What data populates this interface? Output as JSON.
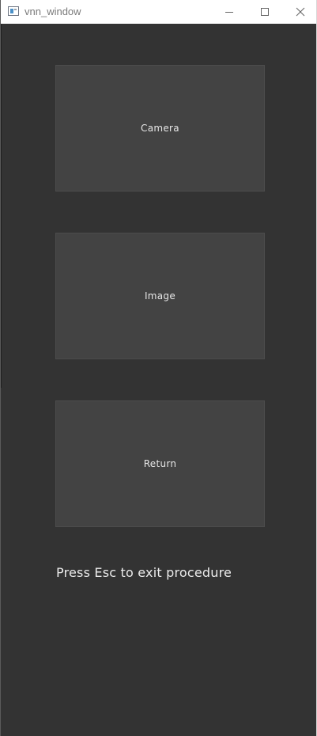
{
  "window": {
    "title": "vnn_window",
    "icons": {
      "app": "app-window-icon",
      "minimize": "minimize-icon",
      "maximize": "maximize-icon",
      "close": "close-icon"
    }
  },
  "menu": {
    "camera_label": "Camera",
    "image_label": "Image",
    "return_label": "Return"
  },
  "hint": "Press Esc to exit procedure",
  "colors": {
    "background": "#333333",
    "button": "#434343",
    "text": "#e6e6e6"
  }
}
